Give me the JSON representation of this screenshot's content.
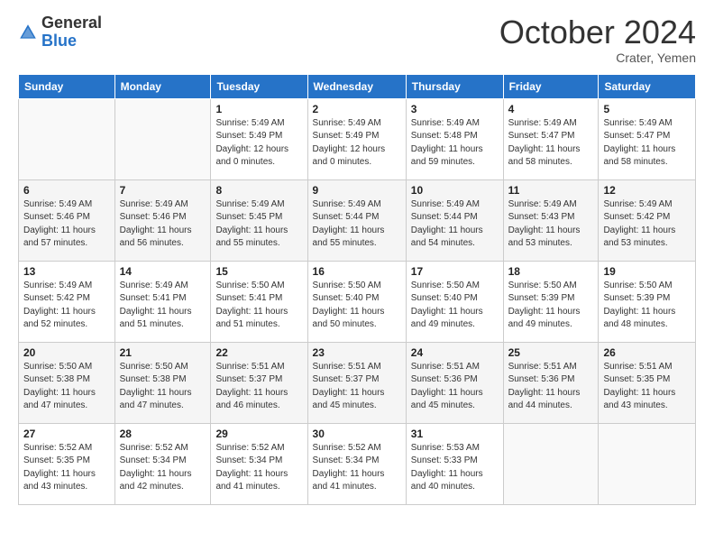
{
  "header": {
    "logo_general": "General",
    "logo_blue": "Blue",
    "month_title": "October 2024",
    "location": "Crater, Yemen"
  },
  "weekdays": [
    "Sunday",
    "Monday",
    "Tuesday",
    "Wednesday",
    "Thursday",
    "Friday",
    "Saturday"
  ],
  "weeks": [
    [
      {
        "day": "",
        "info": ""
      },
      {
        "day": "",
        "info": ""
      },
      {
        "day": "1",
        "info": "Sunrise: 5:49 AM\nSunset: 5:49 PM\nDaylight: 12 hours and 0 minutes."
      },
      {
        "day": "2",
        "info": "Sunrise: 5:49 AM\nSunset: 5:49 PM\nDaylight: 12 hours and 0 minutes."
      },
      {
        "day": "3",
        "info": "Sunrise: 5:49 AM\nSunset: 5:48 PM\nDaylight: 11 hours and 59 minutes."
      },
      {
        "day": "4",
        "info": "Sunrise: 5:49 AM\nSunset: 5:47 PM\nDaylight: 11 hours and 58 minutes."
      },
      {
        "day": "5",
        "info": "Sunrise: 5:49 AM\nSunset: 5:47 PM\nDaylight: 11 hours and 58 minutes."
      }
    ],
    [
      {
        "day": "6",
        "info": "Sunrise: 5:49 AM\nSunset: 5:46 PM\nDaylight: 11 hours and 57 minutes."
      },
      {
        "day": "7",
        "info": "Sunrise: 5:49 AM\nSunset: 5:46 PM\nDaylight: 11 hours and 56 minutes."
      },
      {
        "day": "8",
        "info": "Sunrise: 5:49 AM\nSunset: 5:45 PM\nDaylight: 11 hours and 55 minutes."
      },
      {
        "day": "9",
        "info": "Sunrise: 5:49 AM\nSunset: 5:44 PM\nDaylight: 11 hours and 55 minutes."
      },
      {
        "day": "10",
        "info": "Sunrise: 5:49 AM\nSunset: 5:44 PM\nDaylight: 11 hours and 54 minutes."
      },
      {
        "day": "11",
        "info": "Sunrise: 5:49 AM\nSunset: 5:43 PM\nDaylight: 11 hours and 53 minutes."
      },
      {
        "day": "12",
        "info": "Sunrise: 5:49 AM\nSunset: 5:42 PM\nDaylight: 11 hours and 53 minutes."
      }
    ],
    [
      {
        "day": "13",
        "info": "Sunrise: 5:49 AM\nSunset: 5:42 PM\nDaylight: 11 hours and 52 minutes."
      },
      {
        "day": "14",
        "info": "Sunrise: 5:49 AM\nSunset: 5:41 PM\nDaylight: 11 hours and 51 minutes."
      },
      {
        "day": "15",
        "info": "Sunrise: 5:50 AM\nSunset: 5:41 PM\nDaylight: 11 hours and 51 minutes."
      },
      {
        "day": "16",
        "info": "Sunrise: 5:50 AM\nSunset: 5:40 PM\nDaylight: 11 hours and 50 minutes."
      },
      {
        "day": "17",
        "info": "Sunrise: 5:50 AM\nSunset: 5:40 PM\nDaylight: 11 hours and 49 minutes."
      },
      {
        "day": "18",
        "info": "Sunrise: 5:50 AM\nSunset: 5:39 PM\nDaylight: 11 hours and 49 minutes."
      },
      {
        "day": "19",
        "info": "Sunrise: 5:50 AM\nSunset: 5:39 PM\nDaylight: 11 hours and 48 minutes."
      }
    ],
    [
      {
        "day": "20",
        "info": "Sunrise: 5:50 AM\nSunset: 5:38 PM\nDaylight: 11 hours and 47 minutes."
      },
      {
        "day": "21",
        "info": "Sunrise: 5:50 AM\nSunset: 5:38 PM\nDaylight: 11 hours and 47 minutes."
      },
      {
        "day": "22",
        "info": "Sunrise: 5:51 AM\nSunset: 5:37 PM\nDaylight: 11 hours and 46 minutes."
      },
      {
        "day": "23",
        "info": "Sunrise: 5:51 AM\nSunset: 5:37 PM\nDaylight: 11 hours and 45 minutes."
      },
      {
        "day": "24",
        "info": "Sunrise: 5:51 AM\nSunset: 5:36 PM\nDaylight: 11 hours and 45 minutes."
      },
      {
        "day": "25",
        "info": "Sunrise: 5:51 AM\nSunset: 5:36 PM\nDaylight: 11 hours and 44 minutes."
      },
      {
        "day": "26",
        "info": "Sunrise: 5:51 AM\nSunset: 5:35 PM\nDaylight: 11 hours and 43 minutes."
      }
    ],
    [
      {
        "day": "27",
        "info": "Sunrise: 5:52 AM\nSunset: 5:35 PM\nDaylight: 11 hours and 43 minutes."
      },
      {
        "day": "28",
        "info": "Sunrise: 5:52 AM\nSunset: 5:34 PM\nDaylight: 11 hours and 42 minutes."
      },
      {
        "day": "29",
        "info": "Sunrise: 5:52 AM\nSunset: 5:34 PM\nDaylight: 11 hours and 41 minutes."
      },
      {
        "day": "30",
        "info": "Sunrise: 5:52 AM\nSunset: 5:34 PM\nDaylight: 11 hours and 41 minutes."
      },
      {
        "day": "31",
        "info": "Sunrise: 5:53 AM\nSunset: 5:33 PM\nDaylight: 11 hours and 40 minutes."
      },
      {
        "day": "",
        "info": ""
      },
      {
        "day": "",
        "info": ""
      }
    ]
  ]
}
